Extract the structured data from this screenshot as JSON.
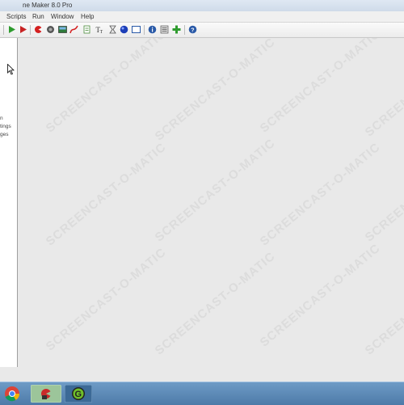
{
  "window": {
    "title": "ne Maker 8.0 Pro"
  },
  "menu": [
    {
      "label": "Scripts"
    },
    {
      "label": "Run"
    },
    {
      "label": "Window"
    },
    {
      "label": "Help"
    }
  ],
  "toolbar": {
    "icons": [
      "run-icon",
      "run-debug-icon",
      "sprite-icon",
      "sound-icon",
      "background-icon",
      "path-icon",
      "script-icon",
      "font-icon",
      "timeline-icon",
      "object-icon",
      "room-icon",
      "game-info-icon",
      "settings-icon",
      "extension-icon",
      "help-icon"
    ]
  },
  "sidebar": {
    "lines": [
      "n",
      "tings",
      "ges"
    ]
  },
  "watermark": {
    "text": "SCREENCAST-O-MATIC"
  },
  "taskbar": {
    "buttons": [
      "start-button",
      "chrome-icon",
      "gamemaker-icon",
      "gamemaker-gear-icon"
    ]
  },
  "colors": {
    "workspace": "#e9e9e9",
    "taskbar": "#5b88b6",
    "run_green": "#2e9b2e",
    "run_red": "#c82323"
  }
}
